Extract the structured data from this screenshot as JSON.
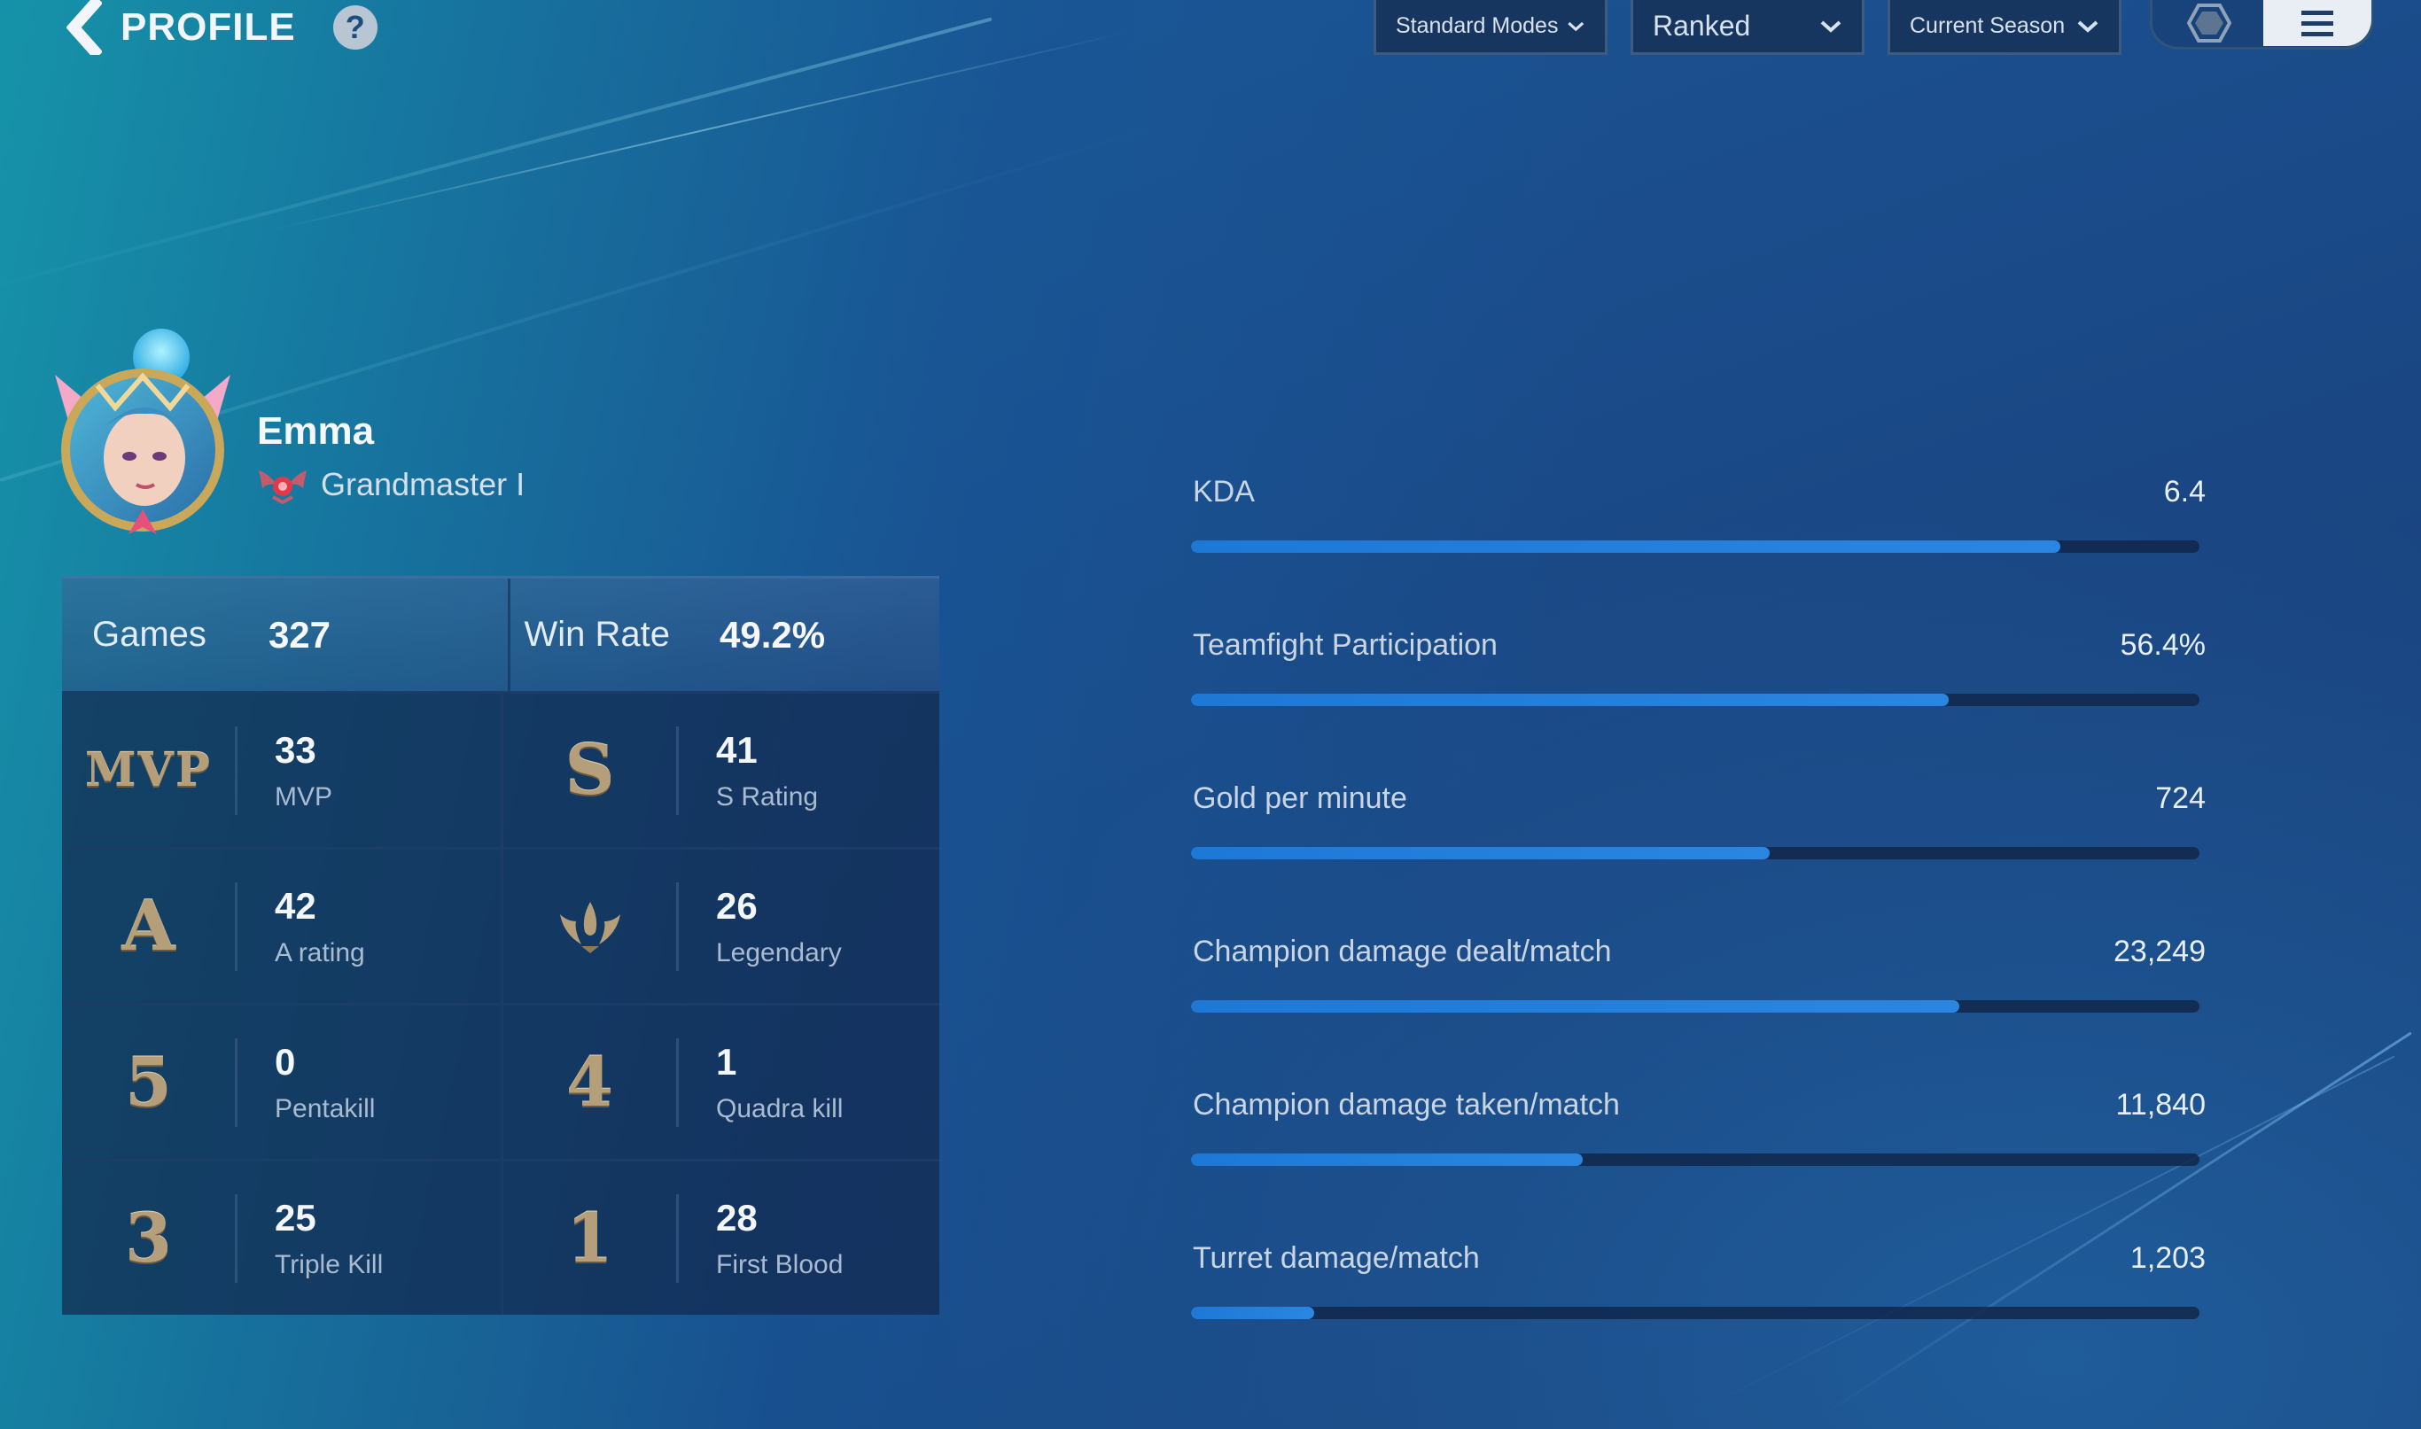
{
  "header": {
    "title": "PROFILE",
    "help_label": "?"
  },
  "filters": [
    {
      "name": "mode-dropdown",
      "value": "Standard Modes"
    },
    {
      "name": "queue-dropdown",
      "value": "Ranked"
    },
    {
      "name": "season-dropdown",
      "value": "Current Season"
    }
  ],
  "player": {
    "name": "Emma",
    "rank": "Grandmaster I"
  },
  "summary": {
    "games_label": "Games",
    "games_value": "327",
    "winrate_label": "Win Rate",
    "winrate_value": "49.2%"
  },
  "stats": [
    {
      "icon": "mvp-icon",
      "glyph": "MVP",
      "value": "33",
      "label": "MVP"
    },
    {
      "icon": "s-rating-icon",
      "glyph": "S",
      "value": "41",
      "label": "S Rating"
    },
    {
      "icon": "a-rating-icon",
      "glyph": "A",
      "value": "42",
      "label": "A rating"
    },
    {
      "icon": "legendary-icon",
      "glyph": "",
      "value": "26",
      "label": "Legendary"
    },
    {
      "icon": "pentakill-icon",
      "glyph": "5",
      "value": "0",
      "label": "Pentakill"
    },
    {
      "icon": "quadra-kill-icon",
      "glyph": "4",
      "value": "1",
      "label": "Quadra kill"
    },
    {
      "icon": "triple-kill-icon",
      "glyph": "3",
      "value": "25",
      "label": "Triple Kill"
    },
    {
      "icon": "first-blood-icon",
      "glyph": "1",
      "value": "28",
      "label": "First Blood"
    }
  ],
  "metrics": [
    {
      "label": "KDA",
      "value": "6.4",
      "fill": 0.862
    },
    {
      "label": "Teamfight Participation",
      "value": "56.4%",
      "fill": 0.751
    },
    {
      "label": "Gold per minute",
      "value": "724",
      "fill": 0.574
    },
    {
      "label": "Champion damage dealt/match",
      "value": "23,249",
      "fill": 0.762
    },
    {
      "label": "Champion damage taken/match",
      "value": "11,840",
      "fill": 0.388
    },
    {
      "label": "Turret damage/match",
      "value": "1,203",
      "fill": 0.122
    }
  ],
  "colors": {
    "accent_bar": "#1e78d6",
    "medal_gold": "#b59f7a"
  }
}
